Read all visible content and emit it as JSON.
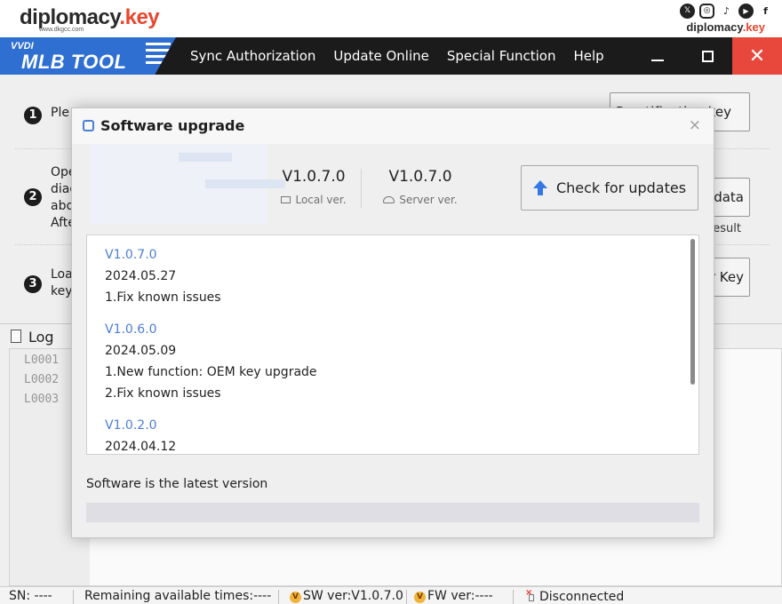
{
  "brand": {
    "logo_main": "diplomacy",
    "logo_accent": ".key",
    "logo_sub": "www.dkgcc.com",
    "right_main": "diplomacy",
    "right_accent": ".key",
    "social_icons": [
      "x-icon",
      "instagram-icon",
      "tiktok-icon",
      "youtube-icon",
      "facebook-icon"
    ],
    "social_glyphs": [
      "𝕏",
      "◎",
      "♪",
      "▶",
      "f"
    ]
  },
  "titlebar": {
    "logo_sup": "VVDI",
    "logo_main": "MLB TOOL",
    "menu": [
      "Sync Authorization",
      "Update Online",
      "Special Function",
      "Help"
    ],
    "minimize_icon": "minimize-icon",
    "maximize_icon": "maximize-icon",
    "close_glyph": "✕"
  },
  "steps": [
    {
      "num": "1",
      "text": "Ple",
      "button": "Re...tification key"
    },
    {
      "num": "2",
      "text": "Ope\ndiag\nabo\nAfte",
      "button": "y data",
      "note": "l result"
    },
    {
      "num": "3",
      "text": "Loa\nkey",
      "button": "er Key"
    }
  ],
  "log": {
    "title": "Log",
    "lines": [
      "L0001",
      "L0002",
      "L0003"
    ]
  },
  "statusbar": {
    "sn": "SN:  ----",
    "remaining": "Remaining available times:----",
    "sw_badge": "V",
    "sw": "SW ver:V1.0.7.0",
    "fw_badge": "V",
    "fw": "FW ver:----",
    "connection": "Disconnected"
  },
  "dialog": {
    "title": "Software upgrade",
    "close_glyph": "×",
    "local_version": "V1.0.7.0",
    "local_label": "Local ver.",
    "server_version": "V1.0.7.0",
    "server_label": "Server ver.",
    "check_button": "Check for updates",
    "changelog": [
      {
        "version": "V1.0.7.0",
        "date": "2024.05.27",
        "notes": [
          "1.Fix known issues"
        ]
      },
      {
        "version": "V1.0.6.0",
        "date": "2024.05.09",
        "notes": [
          "1.New function: OEM key upgrade",
          "2.Fix known issues"
        ]
      },
      {
        "version": "V1.0.2.0",
        "date": "2024.04.12",
        "notes": []
      }
    ],
    "status": "Software is the latest version",
    "progress": 0
  },
  "colors": {
    "accent_blue": "#3578e5",
    "brand_red": "#e8462e",
    "titlebar": "#1b1b1b",
    "close_red": "#e8473c"
  }
}
